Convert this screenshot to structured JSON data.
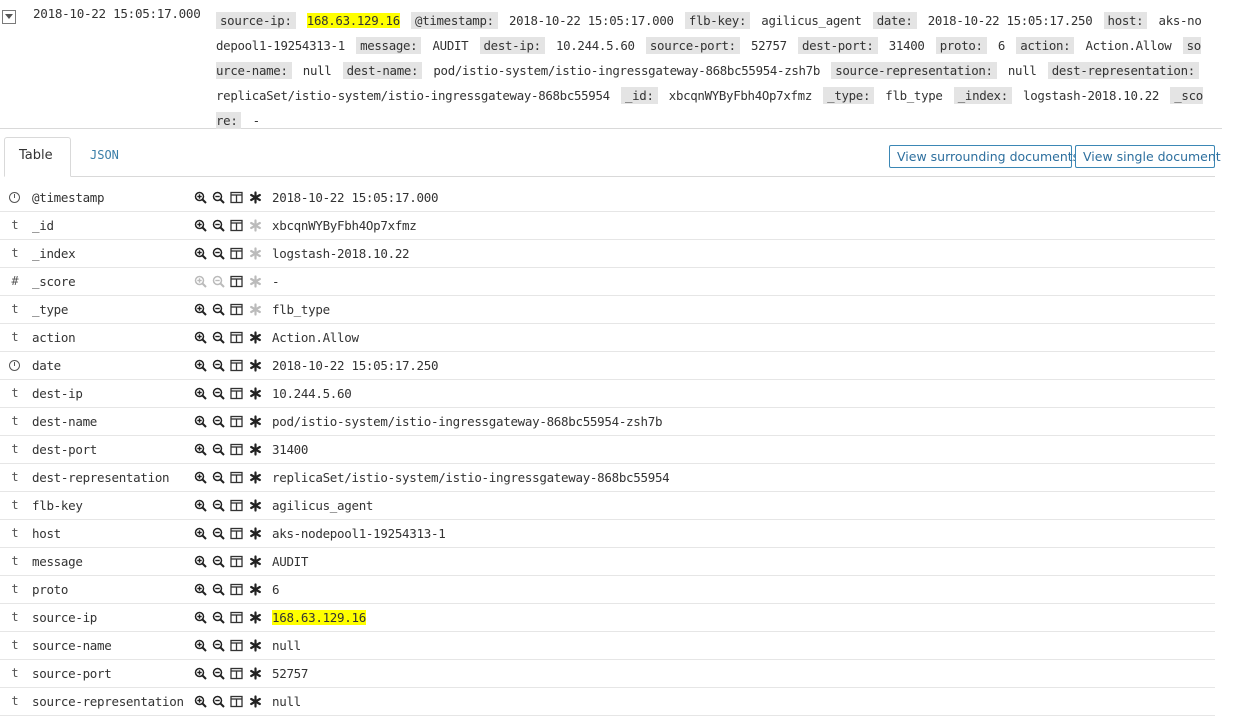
{
  "summary": {
    "timestamp": "2018-10-22 15:05:17.000",
    "fields": [
      {
        "key": "source-ip:",
        "value": "168.63.129.16",
        "highlight": true
      },
      {
        "key": "@timestamp:",
        "value": "2018-10-22 15:05:17.000"
      },
      {
        "key": "flb-key:",
        "value": "agilicus_agent"
      },
      {
        "key": "date:",
        "value": "2018-10-22 15:05:17.250"
      },
      {
        "key": "host:",
        "value": "aks-nodepool1-19254313-1"
      },
      {
        "key": "message:",
        "value": "AUDIT"
      },
      {
        "key": "dest-ip:",
        "value": "10.244.5.60"
      },
      {
        "key": "source-port:",
        "value": "52757"
      },
      {
        "key": "dest-port:",
        "value": "31400"
      },
      {
        "key": "proto:",
        "value": "6"
      },
      {
        "key": "action:",
        "value": "Action.Allow"
      },
      {
        "key": "source-name:",
        "value": "null"
      },
      {
        "key": "dest-name:",
        "value": "pod/istio-system/istio-ingressgateway-868bc55954-zsh7b"
      },
      {
        "key": "source-representation:",
        "value": "null"
      },
      {
        "key": "dest-representation:",
        "value": "replicaSet/istio-system/istio-ingressgateway-868bc55954"
      },
      {
        "key": "_id:",
        "value": "xbcqnWYByFbh4Op7xfmz"
      },
      {
        "key": "_type:",
        "value": "flb_type"
      },
      {
        "key": "_index:",
        "value": "logstash-2018.10.22"
      },
      {
        "key": "_score:",
        "value": " -"
      }
    ]
  },
  "tabs": [
    {
      "label": "Table",
      "active": true
    },
    {
      "label": "JSON",
      "active": false
    }
  ],
  "buttons": {
    "surrounding": "View surrounding documents",
    "single": "View single document"
  },
  "rows": [
    {
      "type": "clock",
      "name": "@timestamp",
      "value": "2018-10-22 15:05:17.000",
      "disabled": false,
      "star_disabled": false
    },
    {
      "type": "t",
      "name": "_id",
      "value": "xbcqnWYByFbh4Op7xfmz",
      "disabled": false,
      "star_disabled": true
    },
    {
      "type": "t",
      "name": "_index",
      "value": "logstash-2018.10.22",
      "disabled": false,
      "star_disabled": true
    },
    {
      "type": "#",
      "name": "_score",
      "value": " -",
      "disabled": true,
      "star_disabled": true
    },
    {
      "type": "t",
      "name": "_type",
      "value": "flb_type",
      "disabled": false,
      "star_disabled": true
    },
    {
      "type": "t",
      "name": "action",
      "value": "Action.Allow",
      "disabled": false,
      "star_disabled": false
    },
    {
      "type": "clock",
      "name": "date",
      "value": "2018-10-22 15:05:17.250",
      "disabled": false,
      "star_disabled": false
    },
    {
      "type": "t",
      "name": "dest-ip",
      "value": "10.244.5.60",
      "disabled": false,
      "star_disabled": false
    },
    {
      "type": "t",
      "name": "dest-name",
      "value": "pod/istio-system/istio-ingressgateway-868bc55954-zsh7b",
      "disabled": false,
      "star_disabled": false
    },
    {
      "type": "t",
      "name": "dest-port",
      "value": "31400",
      "disabled": false,
      "star_disabled": false
    },
    {
      "type": "t",
      "name": "dest-representation",
      "value": "replicaSet/istio-system/istio-ingressgateway-868bc55954",
      "disabled": false,
      "star_disabled": false
    },
    {
      "type": "t",
      "name": "flb-key",
      "value": "agilicus_agent",
      "disabled": false,
      "star_disabled": false
    },
    {
      "type": "t",
      "name": "host",
      "value": "aks-nodepool1-19254313-1",
      "disabled": false,
      "star_disabled": false
    },
    {
      "type": "t",
      "name": "message",
      "value": "AUDIT",
      "disabled": false,
      "star_disabled": false
    },
    {
      "type": "t",
      "name": "proto",
      "value": "6",
      "disabled": false,
      "star_disabled": false
    },
    {
      "type": "t",
      "name": "source-ip",
      "value": "168.63.129.16",
      "highlight": true,
      "disabled": false,
      "star_disabled": false
    },
    {
      "type": "t",
      "name": "source-name",
      "value": "null",
      "disabled": false,
      "star_disabled": false
    },
    {
      "type": "t",
      "name": "source-port",
      "value": "52757",
      "disabled": false,
      "star_disabled": false
    },
    {
      "type": "t",
      "name": "source-representation",
      "value": "null",
      "disabled": false,
      "star_disabled": false
    }
  ],
  "icons": {
    "zoom_in": "magnify-plus-icon",
    "zoom_out": "magnify-minus-icon",
    "columns": "toggle-column-icon",
    "filter_exists": "asterisk-icon"
  },
  "colors": {
    "highlight": "#ffff00",
    "link": "#3a7ea8",
    "button_border": "#3b87b5",
    "key_bg": "#e4e4e4"
  }
}
